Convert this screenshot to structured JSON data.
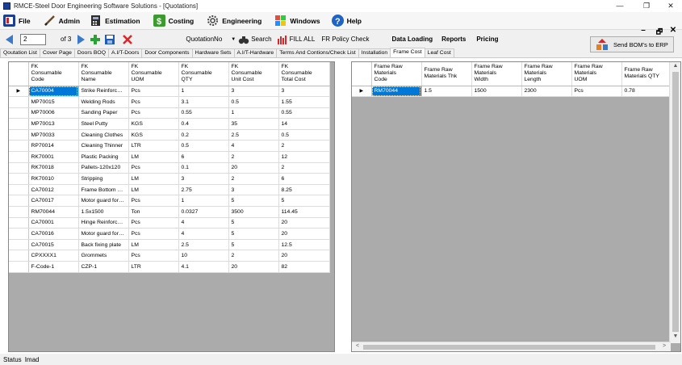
{
  "window": {
    "title": "RMCE-Steel Door Engineering Software Solutions - [Quotations]",
    "controls": {
      "minimize": "—",
      "restore": "❐",
      "close": "✕"
    }
  },
  "menu": {
    "items": [
      {
        "label": "File",
        "icon": "book-icon",
        "color": "#1c3f94"
      },
      {
        "label": "Admin",
        "icon": "pencil-icon",
        "color": "#6b4b2a"
      },
      {
        "label": "Estimation",
        "icon": "calculator-icon",
        "color": "#2c2c2c"
      },
      {
        "label": "Costing",
        "icon": "dollar-icon",
        "color": "#3c9b2f"
      },
      {
        "label": "Engineering",
        "icon": "gear-icon",
        "color": "#555555"
      },
      {
        "label": "Windows",
        "icon": "windows-icon",
        "color": "#e0a000"
      },
      {
        "label": "Help",
        "icon": "help-icon",
        "color": "#1e63c6"
      }
    ],
    "mdi_controls": {
      "minimize": "–",
      "restore": "🗗",
      "close": "✕"
    }
  },
  "toolbar": {
    "page_value": "2",
    "page_of": "of 3",
    "search_field_label": "QuotationNo",
    "search_label": "Search",
    "fill_all_label": "FILL ALL",
    "fr_policy_label": "FR Policy Check",
    "data_loading_label": "Data Loading",
    "reports_label": "Reports",
    "pricing_label": "Pricing",
    "send_erp_label": "Send BOM's to ERP"
  },
  "tabs": [
    "Qoutation List",
    "Cover Page",
    "Doors BOQ",
    "A.I/T-Doors",
    "Door Components",
    "Hardware Sets",
    "A.I/T-Hardware",
    "Terms And Contions/Check List",
    "Installation",
    "Frame Cost",
    "Leaf Cost"
  ],
  "active_tab": "Frame Cost",
  "consumables_grid": {
    "columns": [
      "FK\nConsumable\nCode",
      "FK\nConsumable\nName",
      "FK\nConsumable\nUOM",
      "FK\nConsumable\nQTY",
      "FK\nConsumable\nUnit Cost",
      "FK\nConsumable\nTotal Cost"
    ],
    "rows": [
      [
        "CA70004",
        "Strike Reinforcement",
        "Pcs",
        "1",
        "3",
        "3"
      ],
      [
        "MP70015",
        "Welding Rods",
        "Pcs",
        "3.1",
        "0.5",
        "1.55"
      ],
      [
        "MP70006",
        "Sanding Paper",
        "Pcs",
        "0.55",
        "1",
        "0.55"
      ],
      [
        "MP70013",
        "Steel Putty",
        "KGS",
        "0.4",
        "35",
        "14"
      ],
      [
        "MP70033",
        "Cleaning Clothes",
        "KGS",
        "0.2",
        "2.5",
        "0.5"
      ],
      [
        "RP70014",
        "Cleaning Thinner",
        "LTR",
        "0.5",
        "4",
        "2"
      ],
      [
        "RK70001",
        "Plastic Packing",
        "LM",
        "6",
        "2",
        "12"
      ],
      [
        "RK70018",
        "Pallets-120x120",
        "Pcs",
        "0.1",
        "20",
        "2"
      ],
      [
        "RK70010",
        "Stripping",
        "LM",
        "3",
        "2",
        "6"
      ],
      [
        "CA70012",
        "Frame Bottom Spreader",
        "LM",
        "2.75",
        "3",
        "8.25"
      ],
      [
        "CA70017",
        "Motor guard for strike",
        "Pcs",
        "1",
        "5",
        "5"
      ],
      [
        "RM70044",
        "1.5x1500",
        "Ton",
        "0.0327",
        "3500",
        "114.45"
      ],
      [
        "CA70001",
        "Hinge Reinforcement",
        "Pcs",
        "4",
        "5",
        "20"
      ],
      [
        "CA70016",
        "Motor guard for hinge",
        "Pcs",
        "4",
        "5",
        "20"
      ],
      [
        "CA70015",
        "Back fixing plate",
        "LM",
        "2.5",
        "5",
        "12.5"
      ],
      [
        "CPXXXX1",
        "Grommets",
        "Pcs",
        "10",
        "2",
        "20"
      ],
      [
        "F-Code-1",
        "CZP-1",
        "LTR",
        "4.1",
        "20",
        "82"
      ]
    ],
    "selected_row": 0,
    "row_indicator": "▶"
  },
  "materials_grid": {
    "columns": [
      "Frame Raw\nMaterials\nCode",
      "Frame Raw\nMaterials Thk",
      "Frame Raw\nMaterials\nWidth",
      "Frame Raw\nMaterials\nLength",
      "Frame Raw\nMaterials\nUOM",
      "Frame Raw\nMaterials QTY"
    ],
    "rows": [
      [
        "RM70044",
        "1.5",
        "1500",
        "2300",
        "Pcs",
        "0.78"
      ]
    ],
    "row_indicator": "▶",
    "scroll": {
      "up": "▲",
      "down": "▼",
      "left": "<",
      "right": ">"
    }
  },
  "status": {
    "label": "Status",
    "user": "Imad"
  },
  "colors": {
    "selection": "#0078d7",
    "grid_background": "#ababab",
    "accent_green": "#2aa236",
    "accent_red": "#d9262b"
  }
}
